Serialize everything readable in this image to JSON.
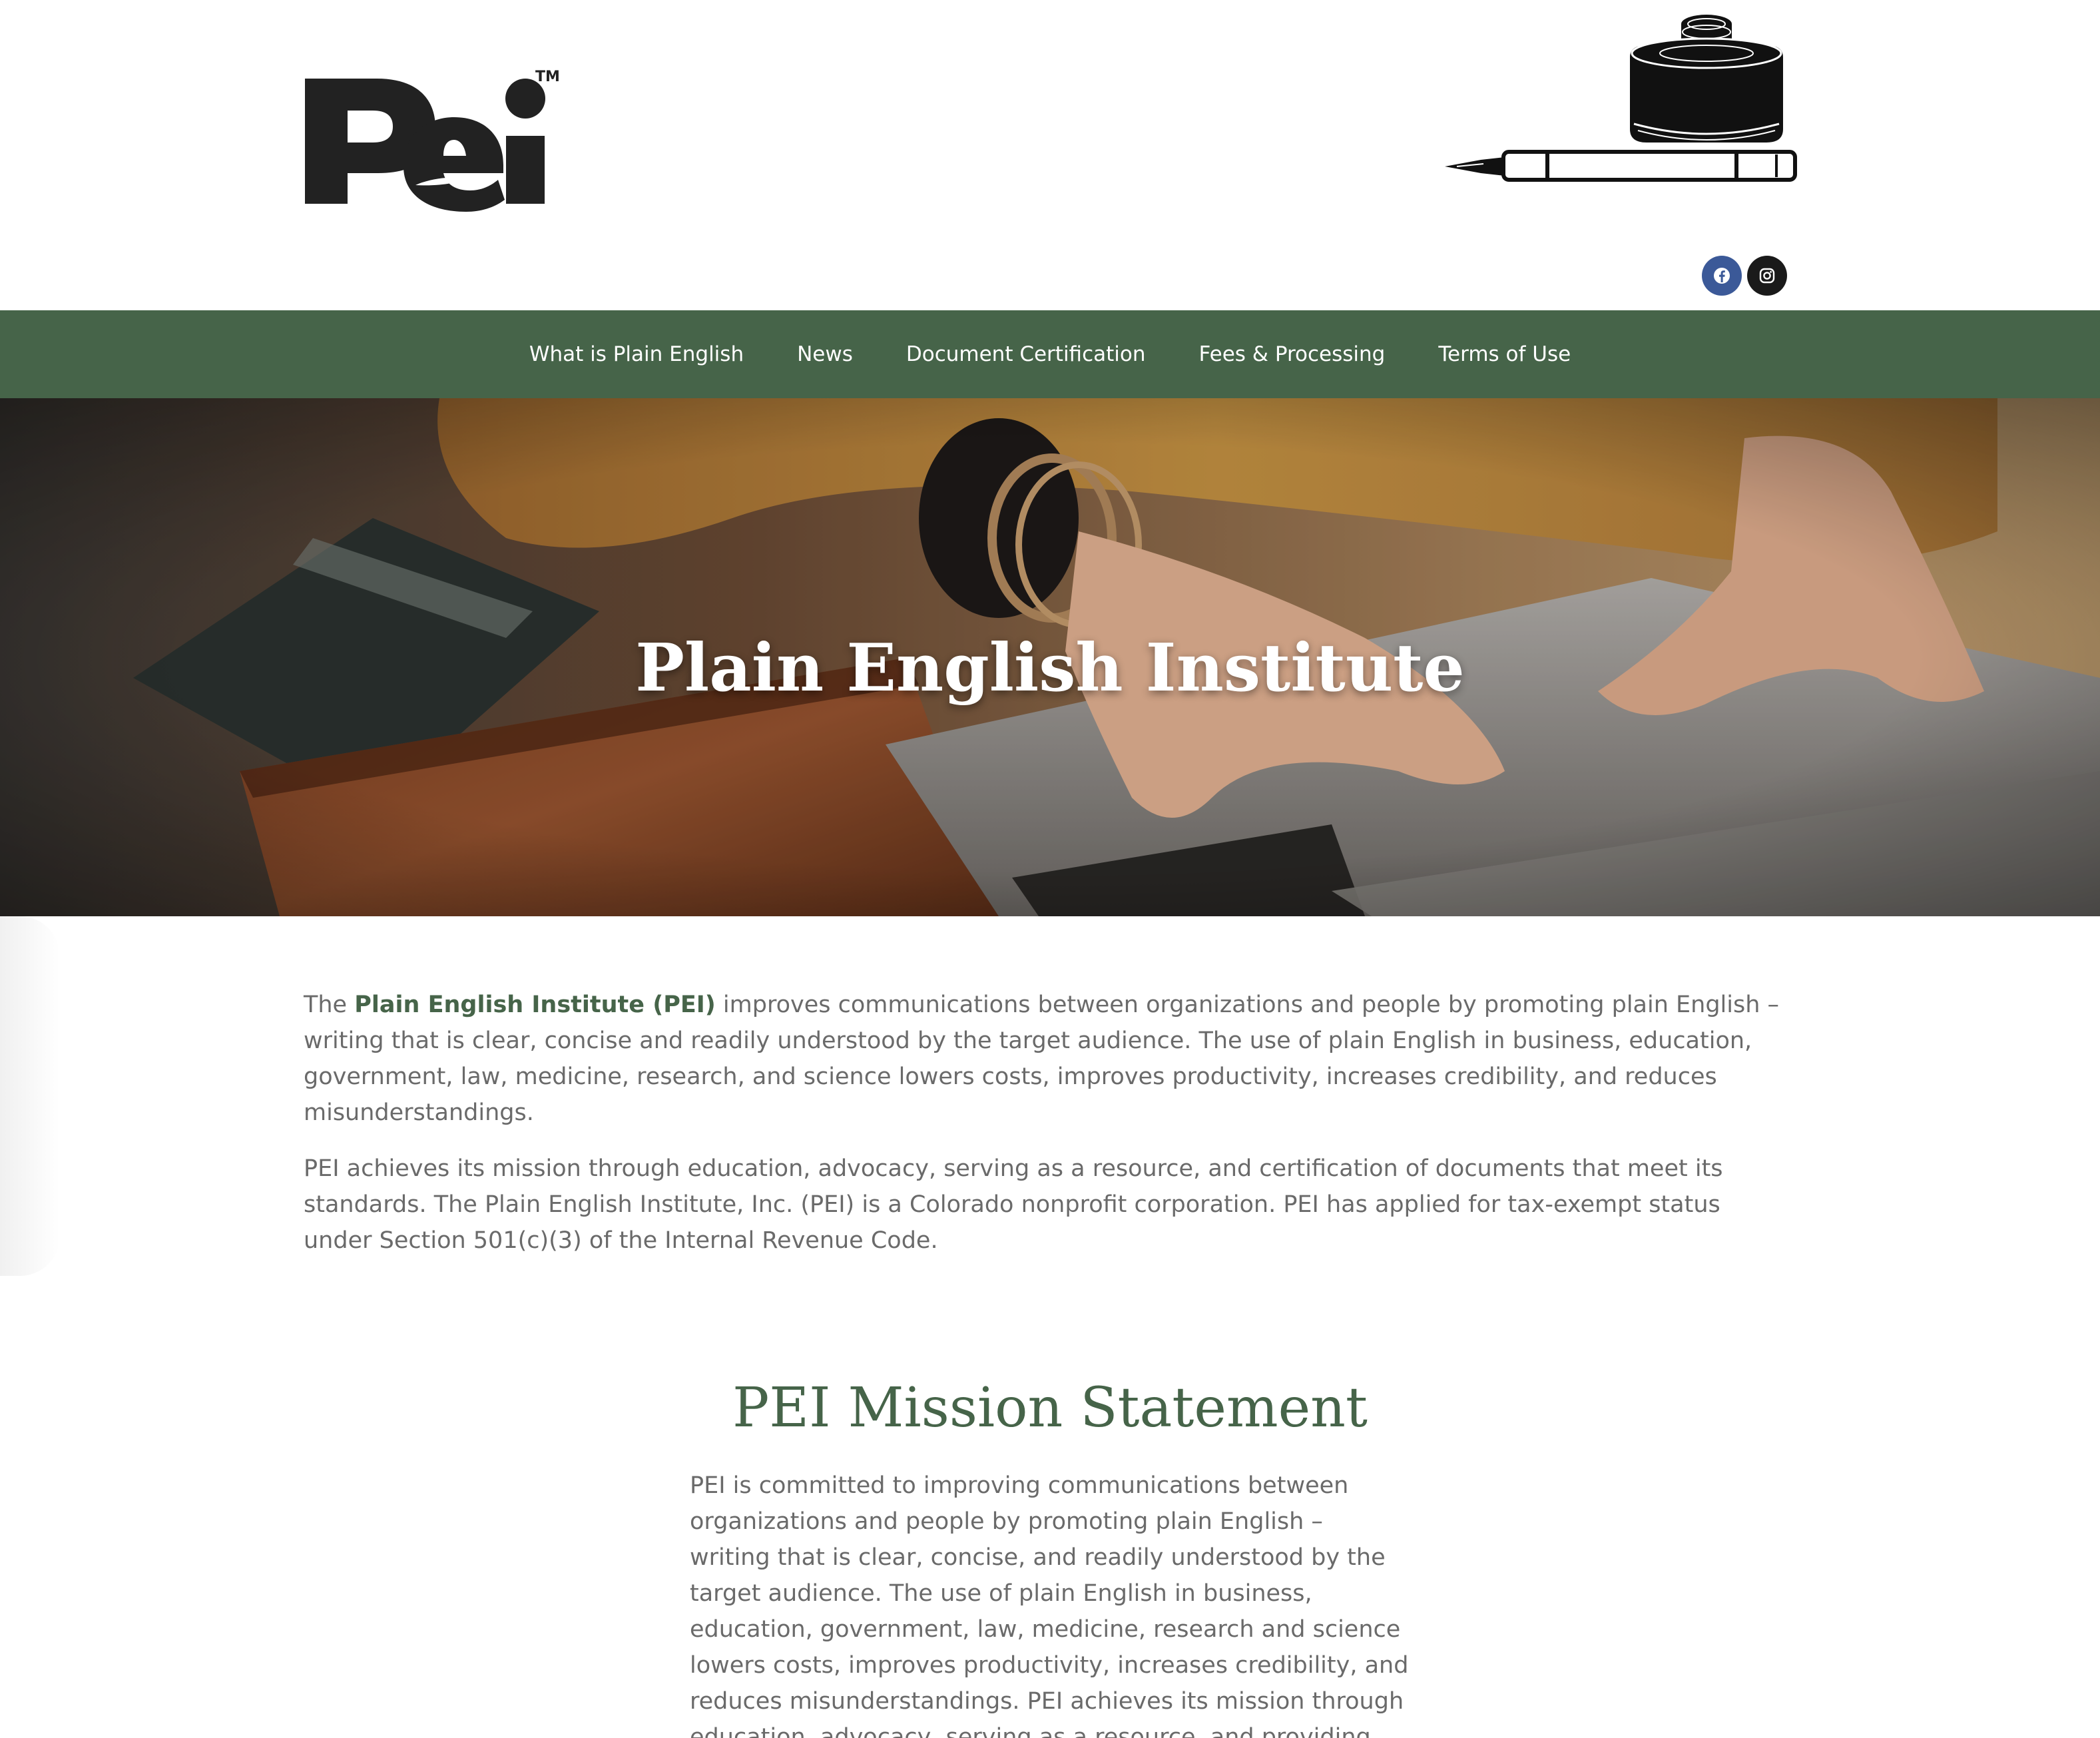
{
  "header": {
    "logo_text": "PEI",
    "logo_trademark": "TM"
  },
  "social": {
    "facebook": "facebook-icon",
    "instagram": "instagram-icon"
  },
  "nav": {
    "items": [
      {
        "label": "What is Plain English"
      },
      {
        "label": "News"
      },
      {
        "label": "Document Certification"
      },
      {
        "label": "Fees & Processing"
      },
      {
        "label": "Terms of Use"
      }
    ]
  },
  "hero": {
    "title": "Plain English Institute"
  },
  "intro": {
    "p1_prefix": "The ",
    "p1_bold": "Plain English Institute (PEI)",
    "p1_rest": " improves communications between organizations and people by promoting plain English – writing that is clear, concise and readily understood by the target audience.  The use of plain English in business, education, government, law, medicine, research, and science lowers costs, improves productivity, increases credibility, and reduces misunderstandings.",
    "p2": "PEI achieves its mission through education, advocacy, serving as a resource, and certification of documents that meet its standards.  The Plain English Institute, Inc. (PEI) is a Colorado nonprofit corporation. PEI has applied for tax-exempt status under Section 501(c)(3) of the Internal Revenue Code."
  },
  "mission": {
    "title": "PEI Mission Statement",
    "text": "PEI is committed to improving communications between organizations and people by promoting plain English – writing that is clear, concise, and readily understood by the target audience.  The use of plain English in business, education, government, law, medicine, research and science lowers costs, improves productivity, increases credibility, and reduces misunderstandings.  PEI achieves its mission through education, advocacy, serving as a resource, and providing"
  },
  "colors": {
    "brand_green": "#466449",
    "facebook_blue": "#3b5998",
    "text_gray": "#6a6a6a"
  }
}
